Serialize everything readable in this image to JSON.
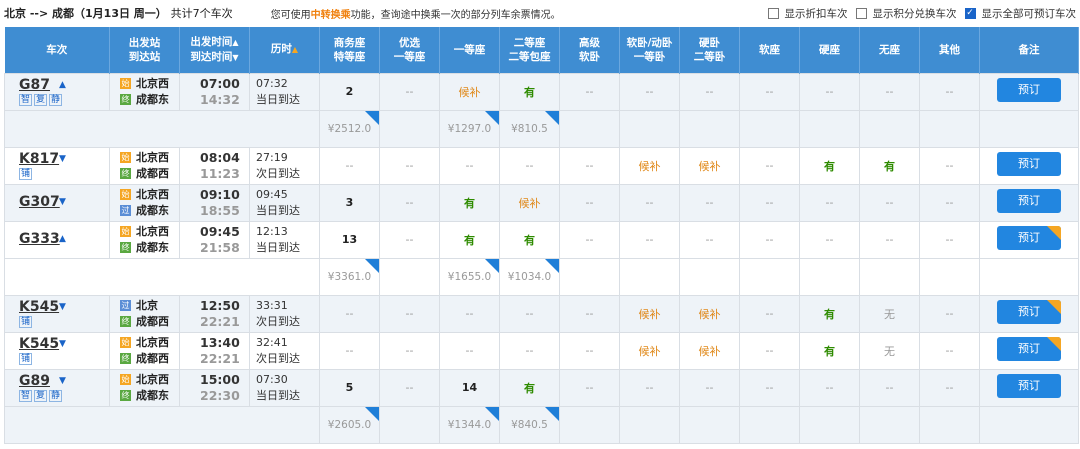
{
  "header": {
    "route": "北京 --> 成都（1月13日 周一）",
    "count": "共计7个车次",
    "hint_pre": "您可使用",
    "hint_link": "中转换乘",
    "hint_post": "功能，查询途中换乘一次的部分列车余票情况。",
    "options": [
      {
        "label": "显示折扣车次",
        "checked": false
      },
      {
        "label": "显示积分兑换车次",
        "checked": false
      },
      {
        "label": "显示全部可预订车次",
        "checked": true
      }
    ]
  },
  "columns": {
    "train": "车次",
    "station_a": "出发站",
    "station_b": "到达站",
    "time_a": "出发时间",
    "time_b": "到达时间",
    "duration": "历时",
    "business_a": "商务座",
    "business_b": "特等座",
    "premium_a": "优选",
    "premium_b": "一等座",
    "first": "一等座",
    "second_a": "二等座",
    "second_b": "二等包座",
    "deluxe_a": "高级",
    "deluxe_b": "软卧",
    "soft_a": "软卧/动卧",
    "soft_b": "一等卧",
    "hard_a": "硬卧",
    "hard_b": "二等卧",
    "softseat": "软座",
    "hardseat": "硬座",
    "noseat": "无座",
    "other": "其他",
    "remark": "备注"
  },
  "trains": [
    {
      "no": "G87",
      "tags": [
        "智",
        "复",
        "静"
      ],
      "from": "北京西",
      "to": "成都东",
      "dep": "07:00",
      "arr": "14:32",
      "dur": "07:32",
      "day": "当日到达",
      "seats": [
        "2",
        "--",
        "候补",
        "有",
        "--",
        "--",
        "--",
        "--",
        "--",
        "--",
        "--"
      ],
      "book": "预订",
      "flag": false,
      "prices": [
        "¥2512.0",
        "",
        "¥1297.0",
        "¥810.5",
        "",
        "",
        "",
        "",
        "",
        "",
        ""
      ]
    },
    {
      "no": "K817",
      "tags": [
        "铺"
      ],
      "from": "北京西",
      "to": "成都西",
      "dep": "08:04",
      "arr": "11:23",
      "dur": "27:19",
      "day": "次日到达",
      "seats": [
        "--",
        "--",
        "--",
        "--",
        "--",
        "候补",
        "候补",
        "--",
        "有",
        "有",
        "--"
      ],
      "book": "预订",
      "flag": false,
      "prices": null
    },
    {
      "no": "G307",
      "tags": [],
      "from": "北京西",
      "to": "成都东",
      "dep": "09:10",
      "arr": "18:55",
      "dur": "09:45",
      "day": "当日到达",
      "seats": [
        "3",
        "--",
        "有",
        "候补",
        "--",
        "--",
        "--",
        "--",
        "--",
        "--",
        "--"
      ],
      "book": "预订",
      "flag": false,
      "prices": null
    },
    {
      "no": "G333",
      "tags": [],
      "from": "北京西",
      "to": "成都东",
      "dep": "09:45",
      "arr": "21:58",
      "dur": "12:13",
      "day": "当日到达",
      "seats": [
        "13",
        "--",
        "有",
        "有",
        "--",
        "--",
        "--",
        "--",
        "--",
        "--",
        "--"
      ],
      "book": "预订",
      "flag": true,
      "prices": [
        "¥3361.0",
        "",
        "¥1655.0",
        "¥1034.0",
        "",
        "",
        "",
        "",
        "",
        "",
        ""
      ]
    },
    {
      "no": "K545",
      "tags": [
        "铺"
      ],
      "from": "北京",
      "to": "成都西",
      "dep": "12:50",
      "arr": "22:21",
      "dur": "33:31",
      "day": "次日到达",
      "seats": [
        "--",
        "--",
        "--",
        "--",
        "--",
        "候补",
        "候补",
        "--",
        "有",
        "无",
        "--"
      ],
      "book": "预订",
      "flag": true,
      "prices": null
    },
    {
      "no": "K545",
      "tags": [
        "铺"
      ],
      "from": "北京西",
      "to": "成都西",
      "dep": "13:40",
      "arr": "22:21",
      "dur": "32:41",
      "day": "次日到达",
      "seats": [
        "--",
        "--",
        "--",
        "--",
        "--",
        "候补",
        "候补",
        "--",
        "有",
        "无",
        "--"
      ],
      "book": "预订",
      "flag": true,
      "prices": null
    },
    {
      "no": "G89",
      "tags": [
        "智",
        "复",
        "静"
      ],
      "from": "北京西",
      "to": "成都东",
      "dep": "15:00",
      "arr": "22:30",
      "dur": "07:30",
      "day": "当日到达",
      "seats": [
        "5",
        "--",
        "14",
        "有",
        "--",
        "--",
        "--",
        "--",
        "--",
        "--",
        "--"
      ],
      "book": "预订",
      "flag": false,
      "prices": [
        "¥2605.0",
        "",
        "¥1344.0",
        "¥840.5",
        "",
        "",
        "",
        "",
        "",
        "",
        ""
      ]
    }
  ]
}
